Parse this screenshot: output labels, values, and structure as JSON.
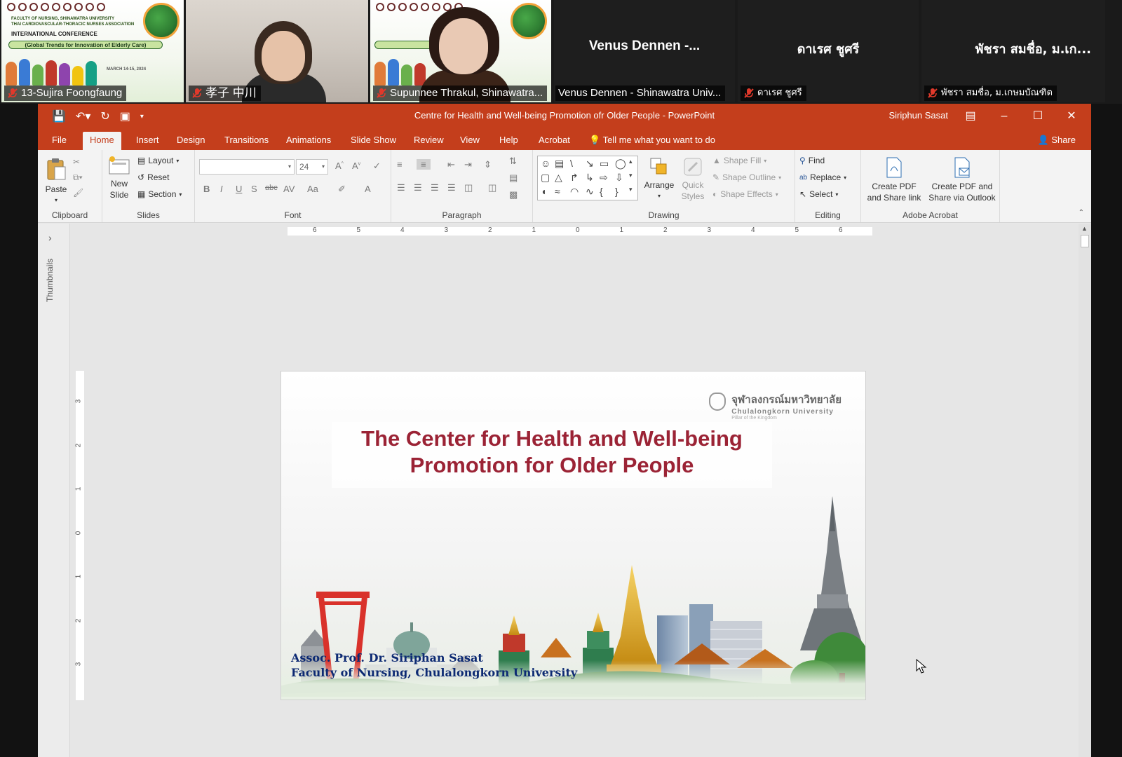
{
  "participants": [
    {
      "name": "13-Sujira Foongfaung",
      "kind": "poster"
    },
    {
      "name": "孝子 中川",
      "kind": "video"
    },
    {
      "name": "Supunnee Thrakul, Shinawatra...",
      "kind": "poster-video"
    },
    {
      "name": "Venus Dennen - Shinawatra Univ...",
      "center": "Venus  Dennen  -...",
      "kind": "name"
    },
    {
      "name": "ดาเรศ ชูศรี",
      "center": "ดาเรศ ชูศรี",
      "kind": "name"
    },
    {
      "name": "พัชรา สมชื่อ, ม.เกษมบัณฑิต",
      "center": "พัชรา สมชื่อ, ม.เก...",
      "kind": "name"
    }
  ],
  "poster": {
    "line1": "FACULTY OF NURSING, SHINAWATRA UNIVERSITY",
    "line2": "THAI CARDIOVASCULAR-THORACIC NURSES ASSOCIATION",
    "line3": "INTERNATIONAL CONFERENCE",
    "banner": "(Global Trends for Innovation of Elderly Care)",
    "date": "MARCH 14-15, 2024"
  },
  "ppt": {
    "doc_title": "Centre for Health and Well-being Promotion ofr Older People  -  PowerPoint",
    "user": "Siriphun Sasat",
    "tabs": [
      "File",
      "Home",
      "Insert",
      "Design",
      "Transitions",
      "Animations",
      "Slide Show",
      "Review",
      "View",
      "Help",
      "Acrobat"
    ],
    "active_tab": "Home",
    "tellme": "Tell me what you want to do",
    "share": "Share",
    "ribbon": {
      "clipboard": {
        "label": "Clipboard",
        "paste": "Paste"
      },
      "slides": {
        "label": "Slides",
        "new_slide": "New\nSlide",
        "layout": "Layout",
        "reset": "Reset",
        "section": "Section"
      },
      "font": {
        "label": "Font",
        "size": "24"
      },
      "paragraph": {
        "label": "Paragraph"
      },
      "drawing": {
        "label": "Drawing",
        "arrange": "Arrange",
        "quick_styles": "Quick\nStyles",
        "shape_fill": "Shape Fill",
        "shape_outline": "Shape Outline",
        "shape_effects": "Shape Effects"
      },
      "editing": {
        "label": "Editing",
        "find": "Find",
        "replace": "Replace",
        "select": "Select"
      },
      "acrobat": {
        "label": "Adobe Acrobat",
        "create_link": "Create PDF\nand Share link",
        "create_outlook": "Create PDF and\nShare via Outlook"
      }
    },
    "thumbnails_label": "Thumbnails"
  },
  "slide": {
    "logo_thai": "จุฬาลงกรณ์มหาวิทยาลัย",
    "logo_en": "Chulalongkorn University",
    "logo_motto": "Pillar of the Kingdom",
    "title_line1": "The Center for Health and Well-being",
    "title_line2": "Promotion for Older People",
    "author_line1": "Assoc. Prof. Dr. Siriphan Sasat",
    "author_line2": "Faculty of Nursing, Chulalongkorn University"
  },
  "colors": {
    "ppt_accent": "#c43e1c",
    "slide_title": "#9b2335",
    "slide_author": "#0d2a73"
  },
  "ruler_h": [
    "6",
    "5",
    "4",
    "3",
    "2",
    "1",
    "0",
    "1",
    "2",
    "3",
    "4",
    "5",
    "6"
  ],
  "ruler_v": [
    "3",
    "2",
    "1",
    "0",
    "1",
    "2",
    "3"
  ]
}
